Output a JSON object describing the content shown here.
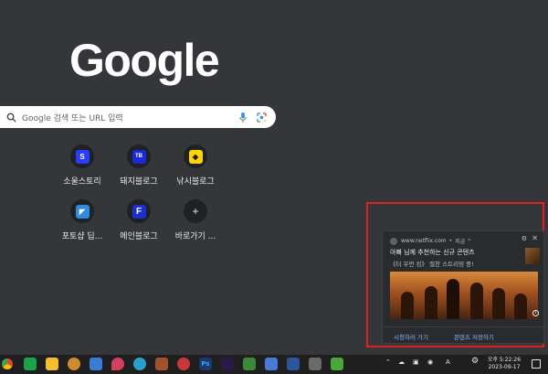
{
  "logo": {
    "text": "Google"
  },
  "search": {
    "placeholder": "Google 검색 또는 URL 입력"
  },
  "shortcuts": [
    {
      "label": "소울스토리",
      "glyph": "S",
      "bg": "#2a3cff",
      "fg": "#ffffff"
    },
    {
      "label": "돼지블로그",
      "glyph": "TB",
      "bg": "#1a2bd6",
      "fg": "#ffffff"
    },
    {
      "label": "낚시블로그",
      "glyph": "◆",
      "bg": "#ffd400",
      "fg": "#1a1a1a"
    },
    {
      "label": "포토샵 딥...",
      "glyph": "◤",
      "bg": "#2f8ddf",
      "fg": "#ffffff"
    },
    {
      "label": "메인블로그",
      "glyph": "F",
      "bg": "#1b2fd0",
      "fg": "#ffffff"
    },
    {
      "label": "바로가기 ...",
      "glyph": "+",
      "bg": "#202124",
      "fg": "#e8eaed"
    }
  ],
  "notification": {
    "site": "www.netflix.com",
    "separator": "•",
    "time": "지금 ^",
    "gear": "⚙",
    "close": "✕",
    "title": "아빠 님께 추천하는 신규 콘텐츠",
    "body": "《더 우먼 킹》 절찬 스트리밍 중!",
    "info": "i",
    "actions": [
      "시청하러 가기",
      "콘텐츠 저장하기"
    ]
  },
  "taskbar": {
    "apps": [
      {
        "name": "chrome-icon",
        "color": "#e8a020"
      },
      {
        "name": "green-app-icon",
        "color": "#1aa34a"
      },
      {
        "name": "folder-icon",
        "color": "#f0c030"
      },
      {
        "name": "media-icon",
        "color": "#d08a30"
      },
      {
        "name": "photos-icon",
        "color": "#3a7bd5"
      },
      {
        "name": "drop-icon",
        "color": "#d04060"
      },
      {
        "name": "edge-icon",
        "color": "#2aa0c8"
      },
      {
        "name": "w-app-icon",
        "color": "#a0522d"
      },
      {
        "name": "record-icon",
        "color": "#c8383a"
      },
      {
        "name": "photoshop-icon",
        "color": "#1b3a6b"
      },
      {
        "name": "premiere-icon",
        "color": "#2a1a4a"
      },
      {
        "name": "drive-icon",
        "color": "#3a8a3a"
      },
      {
        "name": "notes-icon",
        "color": "#4a7ad8"
      },
      {
        "name": "word-icon",
        "color": "#2b579a"
      },
      {
        "name": "video-icon",
        "color": "#6a6a6a"
      },
      {
        "name": "vpn-icon",
        "color": "#4aa83a"
      }
    ],
    "ps_label": "Ps",
    "tray": [
      "⌃",
      "☁",
      "▣",
      "◉",
      "A",
      "⚙"
    ],
    "clock_time": "오후 5:22:26",
    "clock_date": "2023-09-17"
  }
}
